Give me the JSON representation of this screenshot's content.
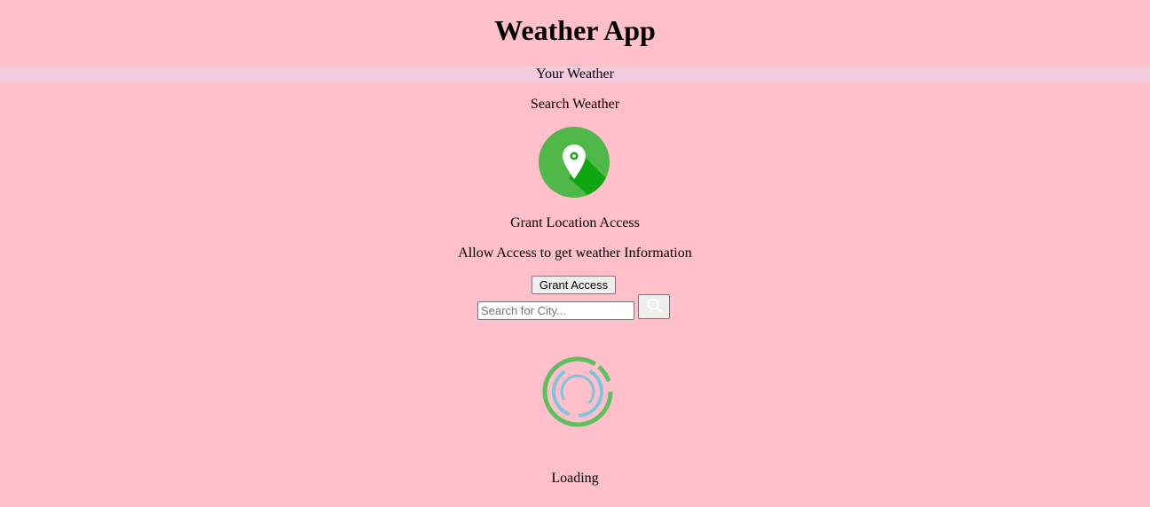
{
  "app": {
    "title": "Weather App"
  },
  "tabs": {
    "your_weather": "Your Weather",
    "search_weather": "Search Weather"
  },
  "grant": {
    "icon": "location-pin-icon",
    "title": "Grant Location Access",
    "description": "Allow Access to get weather Information",
    "button_label": "Grant Access"
  },
  "search": {
    "placeholder": "Search for City...",
    "value": "",
    "button_icon": "search-icon"
  },
  "loading": {
    "icon": "loading-spinner-icon",
    "text": "Loading"
  },
  "colors": {
    "background": "#ffbfcb",
    "active_tab_bg": "#f2cbdc",
    "icon_green": "#4fb848",
    "icon_green_dark": "#0fa70f",
    "spinner_blue": "#7dc4dd"
  }
}
